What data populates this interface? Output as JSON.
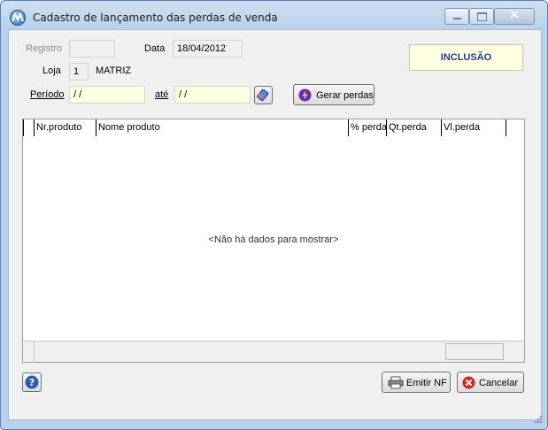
{
  "window": {
    "title": "Cadastro de lançamento das perdas de venda",
    "close_glyph": "✕"
  },
  "form": {
    "registro_label": "Registro",
    "registro_value": "",
    "data_label": "Data",
    "data_value": "18/04/2012",
    "loja_label": "Loja",
    "loja_code": "1",
    "loja_name": "MATRIZ",
    "periodo_label": "Período",
    "periodo_start": " / /",
    "ate_label": "até",
    "periodo_end": " / /",
    "status": "INCLUSÃO"
  },
  "buttons": {
    "gerar_perdas": "Gerar perdas",
    "emitir_nf": "Emitir NF",
    "cancelar": "Cancelar"
  },
  "grid": {
    "columns": [
      "Nr.produto",
      "Nome produto",
      "% perda",
      "Qt.perda",
      "Vl.perda"
    ],
    "rows": [],
    "empty_message": "<Não há dados para mostrar>"
  },
  "icons": {
    "app": "app-logo-icon",
    "eraser": "eraser-icon",
    "gerar": "lightning-icon",
    "printer": "printer-icon",
    "cancel": "cancel-x-icon",
    "help": "help-icon"
  },
  "colors": {
    "title_bar": "#b9d1ec",
    "input_highlight": "#ffffe1",
    "status_text": "#1f3a8a",
    "cancel_red": "#d9251d"
  }
}
